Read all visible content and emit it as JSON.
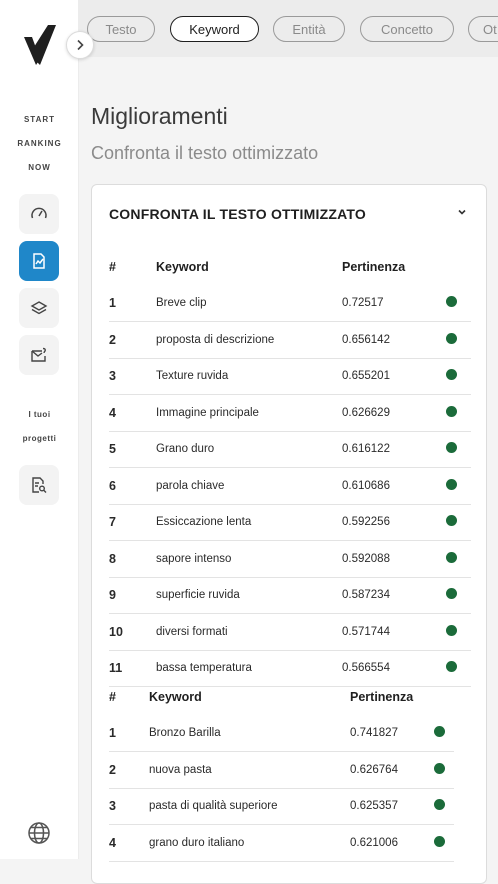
{
  "sidebar": {
    "brand_lines": [
      "START",
      "RANKING",
      "NOW"
    ],
    "projects_lines": [
      "I tuoi",
      "progetti"
    ],
    "nav_icons": [
      "speedometer-icon",
      "chart-document-icon",
      "layers-icon",
      "mail-question-icon"
    ],
    "project_icon": "document-search-icon",
    "accent_color": "#1f87c9"
  },
  "tabs": [
    "Testo",
    "Keyword",
    "Entità",
    "Concetto",
    "Ot"
  ],
  "active_tab": "Keyword",
  "header": {
    "title": "Miglioramenti",
    "subtitle": "Confronta il testo ottimizzato"
  },
  "card": {
    "title": "CONFRONTA IL TESTO OTTIMIZZATO"
  },
  "table1": {
    "headers": [
      "#",
      "Keyword",
      "Pertinenza"
    ],
    "rows": [
      {
        "n": "1",
        "keyword": "Breve clip",
        "score": "0.72517"
      },
      {
        "n": "2",
        "keyword": "proposta di descrizione",
        "score": "0.656142"
      },
      {
        "n": "3",
        "keyword": "Texture ruvida",
        "score": "0.655201"
      },
      {
        "n": "4",
        "keyword": "Immagine principale",
        "score": "0.626629"
      },
      {
        "n": "5",
        "keyword": "Grano duro",
        "score": "0.616122"
      },
      {
        "n": "6",
        "keyword": "parola chiave",
        "score": "0.610686"
      },
      {
        "n": "7",
        "keyword": "Essiccazione lenta",
        "score": "0.592256"
      },
      {
        "n": "8",
        "keyword": "sapore intenso",
        "score": "0.592088"
      },
      {
        "n": "9",
        "keyword": "superficie ruvida",
        "score": "0.587234"
      },
      {
        "n": "10",
        "keyword": "diversi formati",
        "score": "0.571744"
      },
      {
        "n": "11",
        "keyword": "bassa temperatura",
        "score": "0.566554"
      }
    ]
  },
  "table2": {
    "headers": [
      "#",
      "Keyword",
      "Pertinenza"
    ],
    "rows": [
      {
        "n": "1",
        "keyword": "Bronzo Barilla",
        "score": "0.741827"
      },
      {
        "n": "2",
        "keyword": "nuova pasta",
        "score": "0.626764"
      },
      {
        "n": "3",
        "keyword": "pasta di qualità superiore",
        "score": "0.625357"
      },
      {
        "n": "4",
        "keyword": "grano duro italiano",
        "score": "0.621006"
      }
    ]
  },
  "status_color": "#1b6b3a"
}
